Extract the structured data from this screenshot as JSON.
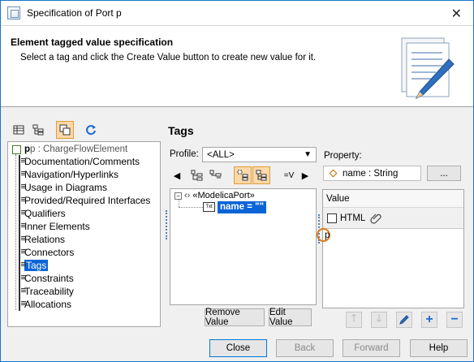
{
  "window": {
    "title": "Specification of Port p",
    "close_glyph": "✕"
  },
  "header": {
    "heading": "Element tagged value specification",
    "description": "Select a tag and click the Create Value button to create new value for it."
  },
  "left_tree": {
    "root_label": "p : ChargeFlowElement",
    "items": [
      {
        "label": "Documentation/Comments"
      },
      {
        "label": "Navigation/Hyperlinks"
      },
      {
        "label": "Usage in Diagrams"
      },
      {
        "label": "Provided/Required Interfaces"
      },
      {
        "label": "Qualifiers"
      },
      {
        "label": "Inner Elements"
      },
      {
        "label": "Relations"
      },
      {
        "label": "Connectors"
      },
      {
        "label": "Tags",
        "selected": true
      },
      {
        "label": "Constraints"
      },
      {
        "label": "Traceability"
      },
      {
        "label": "Allocations"
      }
    ]
  },
  "tags": {
    "title": "Tags",
    "profile_label": "Profile:",
    "profile_value": "<ALL>",
    "stereotype_label": "«ModelicaPort»",
    "tag_label": "name = \"\"",
    "tag_icon_text": "Txt",
    "filter_label": "=V",
    "remove_value": "Remove Value",
    "edit_value": "Edit Value"
  },
  "property": {
    "label": "Property:",
    "value": "name : String",
    "browse_button": "...",
    "value_header": "Value",
    "html_label": "HTML",
    "value_text": "p"
  },
  "footer": {
    "close": "Close",
    "back": "Back",
    "forward": "Forward",
    "help": "Help"
  },
  "colors": {
    "accent": "#0a64d6",
    "window_border": "#1a73c9",
    "highlight_circle": "#e07a1a"
  }
}
